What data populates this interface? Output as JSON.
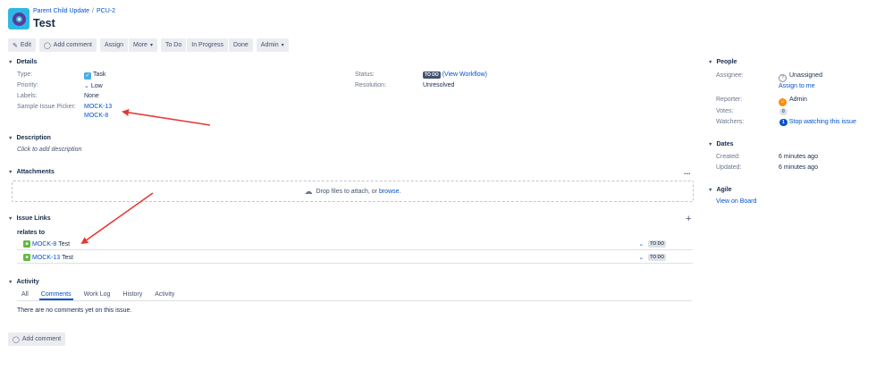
{
  "header": {
    "project_name": "Parent Child Update",
    "issue_key": "PCU-2",
    "title": "Test"
  },
  "toolbar": {
    "edit": "Edit",
    "add_comment": "Add comment",
    "assign": "Assign",
    "more": "More",
    "to_do": "To Do",
    "in_progress": "In Progress",
    "done": "Done",
    "admin": "Admin"
  },
  "details": {
    "heading": "Details",
    "type_label": "Type:",
    "type_value": "Task",
    "priority_label": "Priority:",
    "priority_value": "Low",
    "labels_label": "Labels:",
    "labels_value": "None",
    "picker_label": "Sample Issue Picker:",
    "picker_values": [
      "MOCK-13",
      "MOCK-8"
    ],
    "status_label": "Status:",
    "status_value": "TO DO",
    "view_workflow": "(View Workflow)",
    "resolution_label": "Resolution:",
    "resolution_value": "Unresolved"
  },
  "description": {
    "heading": "Description",
    "placeholder": "Click to add description"
  },
  "attachments": {
    "heading": "Attachments",
    "more": "...",
    "drop_text": "Drop files to attach, or",
    "browse": "browse."
  },
  "issue_links": {
    "heading": "Issue Links",
    "add": "+",
    "relation": "relates to",
    "links": [
      {
        "key": "MOCK-8",
        "summary": "Test",
        "status": "TO DO"
      },
      {
        "key": "MOCK-13",
        "summary": "Test",
        "status": "TO DO"
      }
    ]
  },
  "activity": {
    "heading": "Activity",
    "tabs": [
      "All",
      "Comments",
      "Work Log",
      "History",
      "Activity"
    ],
    "active_tab": "Comments",
    "empty": "There are no comments yet on this issue.",
    "add_comment": "Add comment"
  },
  "people": {
    "heading": "People",
    "assignee_label": "Assignee:",
    "assignee_value": "Unassigned",
    "assign_to_me": "Assign to me",
    "reporter_label": "Reporter:",
    "reporter_value": "Admin",
    "votes_label": "Votes:",
    "votes_value": "0",
    "watchers_label": "Watchers:",
    "watchers_count": "1",
    "watchers_action": "Stop watching this issue"
  },
  "dates": {
    "heading": "Dates",
    "created_label": "Created:",
    "created_value": "6 minutes ago",
    "updated_label": "Updated:",
    "updated_value": "6 minutes ago"
  },
  "agile": {
    "heading": "Agile",
    "view_on_board": "View on Board"
  },
  "colors": {
    "link": "#0052cc",
    "annotation_arrow": "#e53935",
    "project_avatar": "#2fb8e6"
  }
}
